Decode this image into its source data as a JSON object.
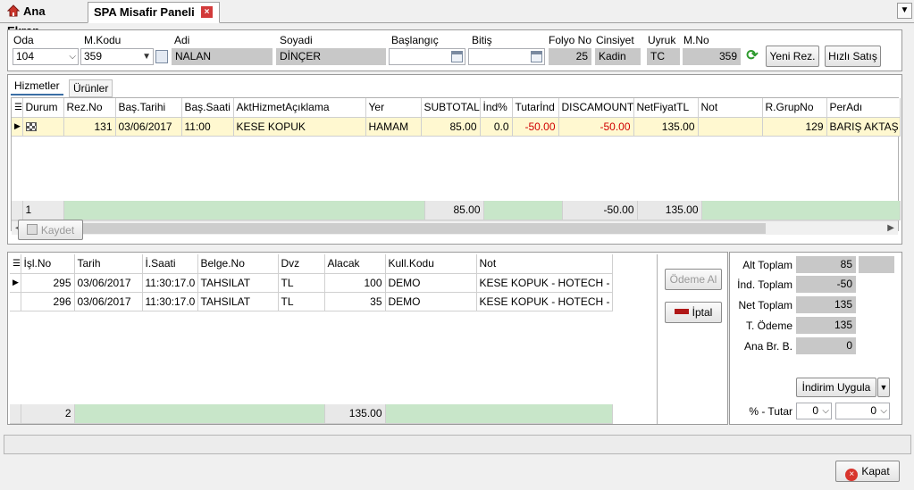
{
  "tabs": [
    {
      "label": "Ana Ekran"
    },
    {
      "label": "SPA Misafir Paneli"
    }
  ],
  "header": {
    "oda": {
      "label": "Oda",
      "value": "104"
    },
    "mkodu": {
      "label": "M.Kodu",
      "value": "359"
    },
    "adi": {
      "label": "Adi",
      "value": "NALAN"
    },
    "soyadi": {
      "label": "Soyadi",
      "value": "DİNÇER"
    },
    "baslangic": {
      "label": "Başlangıç",
      "value": ""
    },
    "bitis": {
      "label": "Bitiş",
      "value": ""
    },
    "folyo": {
      "label": "Folyo No",
      "value": "25"
    },
    "cinsiyet": {
      "label": "Cinsiyet",
      "value": "Kadin"
    },
    "uyruk": {
      "label": "Uyruk",
      "value": "TC"
    },
    "mno": {
      "label": "M.No",
      "value": "359"
    },
    "yeni_rez": "Yeni Rez.",
    "hizli_satis": "Hızlı Satış"
  },
  "inner_tabs": [
    {
      "label": "Hizmetler"
    },
    {
      "label": "Ürünler"
    }
  ],
  "services": {
    "columns": [
      "Durum",
      "Rez.No",
      "Baş.Tarihi",
      "Baş.Saati",
      "AktHizmetAçıklama",
      "Yer",
      "SUBTOTAL",
      "İnd%",
      "Tutarİnd",
      "DISCAMOUNT",
      "NetFiyatTL",
      "Not",
      "R.GrupNo",
      "PerAdı"
    ],
    "rows": [
      {
        "rezno": "131",
        "tarih": "03/06/2017",
        "saat": "11:00",
        "aciklama": "KESE KOPUK",
        "yer": "HAMAM",
        "subtotal": "85.00",
        "ind": "0.0",
        "tutarind": "-50.00",
        "discamount": "-50.00",
        "netfiyat": "135.00",
        "not": "",
        "grupno": "129",
        "peradi": "BARIŞ AKTAŞ"
      }
    ],
    "footer": {
      "count": "1",
      "subtotal": "85.00",
      "discamount": "-50.00",
      "netfiyat": "135.00"
    },
    "kaydet": "Kaydet"
  },
  "payments": {
    "columns": [
      "İşl.No",
      "Tarih",
      "İ.Saati",
      "Belge.No",
      "Dvz",
      "Alacak",
      "Kull.Kodu",
      "Not"
    ],
    "rows": [
      {
        "islno": "295",
        "tarih": "03/06/2017",
        "saat": "11:30:17.0",
        "belge": "TAHSILAT",
        "dvz": "TL",
        "alacak": "100",
        "kull": "DEMO",
        "not": "KESE KOPUK - HOTECH -"
      },
      {
        "islno": "296",
        "tarih": "03/06/2017",
        "saat": "11:30:17.0",
        "belge": "TAHSILAT",
        "dvz": "TL",
        "alacak": "35",
        "kull": "DEMO",
        "not": "KESE KOPUK - HOTECH -"
      }
    ],
    "footer": {
      "count": "2",
      "alacak": "135.00"
    },
    "odeme_al": "Ödeme Al",
    "iptal": "İptal"
  },
  "summary": {
    "alt_toplam": {
      "label": "Alt Toplam",
      "value": "85"
    },
    "ind_toplam": {
      "label": "İnd. Toplam",
      "value": "-50"
    },
    "net_toplam": {
      "label": "Net Toplam",
      "value": "135"
    },
    "t_odeme": {
      "label": "T. Ödeme",
      "value": "135"
    },
    "ana_br": {
      "label": "Ana Br. B.",
      "value": "0"
    },
    "indirim_uygula": "İndirim Uygula",
    "yuzde_tutar": {
      "label": "% - Tutar",
      "pct": "0",
      "amount": "0"
    }
  },
  "kapat": "Kapat",
  "colors": {
    "footer_green": "#c8e6c9",
    "selected_row": "#fff8d0",
    "negative": "#d00000"
  }
}
